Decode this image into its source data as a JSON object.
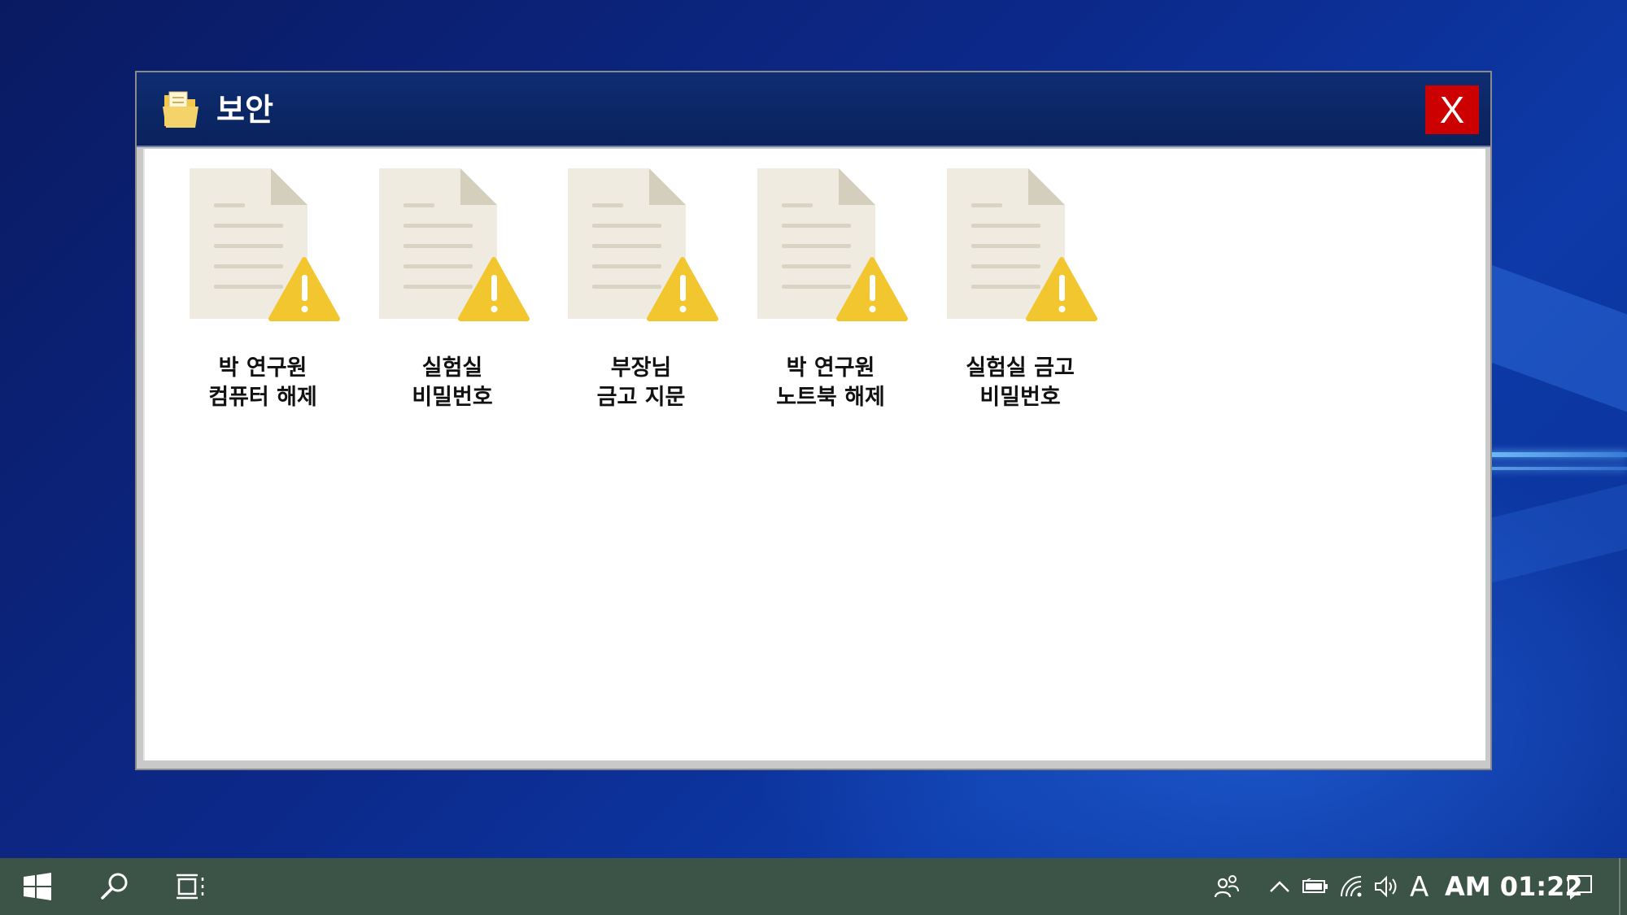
{
  "window": {
    "title": "보안",
    "close_label": "X",
    "colors": {
      "titlebar": "#0b2766",
      "close_bg": "#cc0000",
      "folder_icon": "#f2c94c"
    }
  },
  "files": [
    {
      "line1": "박 연구원",
      "line2": "컴퓨터 해제",
      "icon": "document-warning-icon"
    },
    {
      "line1": "실험실",
      "line2": "비밀번호",
      "icon": "document-warning-icon"
    },
    {
      "line1": "부장님",
      "line2": "금고 지문",
      "icon": "document-warning-icon"
    },
    {
      "line1": "박 연구원",
      "line2": "노트북 해제",
      "icon": "document-warning-icon"
    },
    {
      "line1": "실험실 금고",
      "line2": "비밀번호",
      "icon": "document-warning-icon"
    }
  ],
  "taskbar": {
    "ime": "A",
    "clock": "AM 01:22",
    "icons": [
      "windows-start-icon",
      "search-icon",
      "task-view-icon",
      "people-icon",
      "chevron-up-icon",
      "battery-icon",
      "wifi-icon",
      "volume-icon",
      "notification-icon"
    ]
  }
}
